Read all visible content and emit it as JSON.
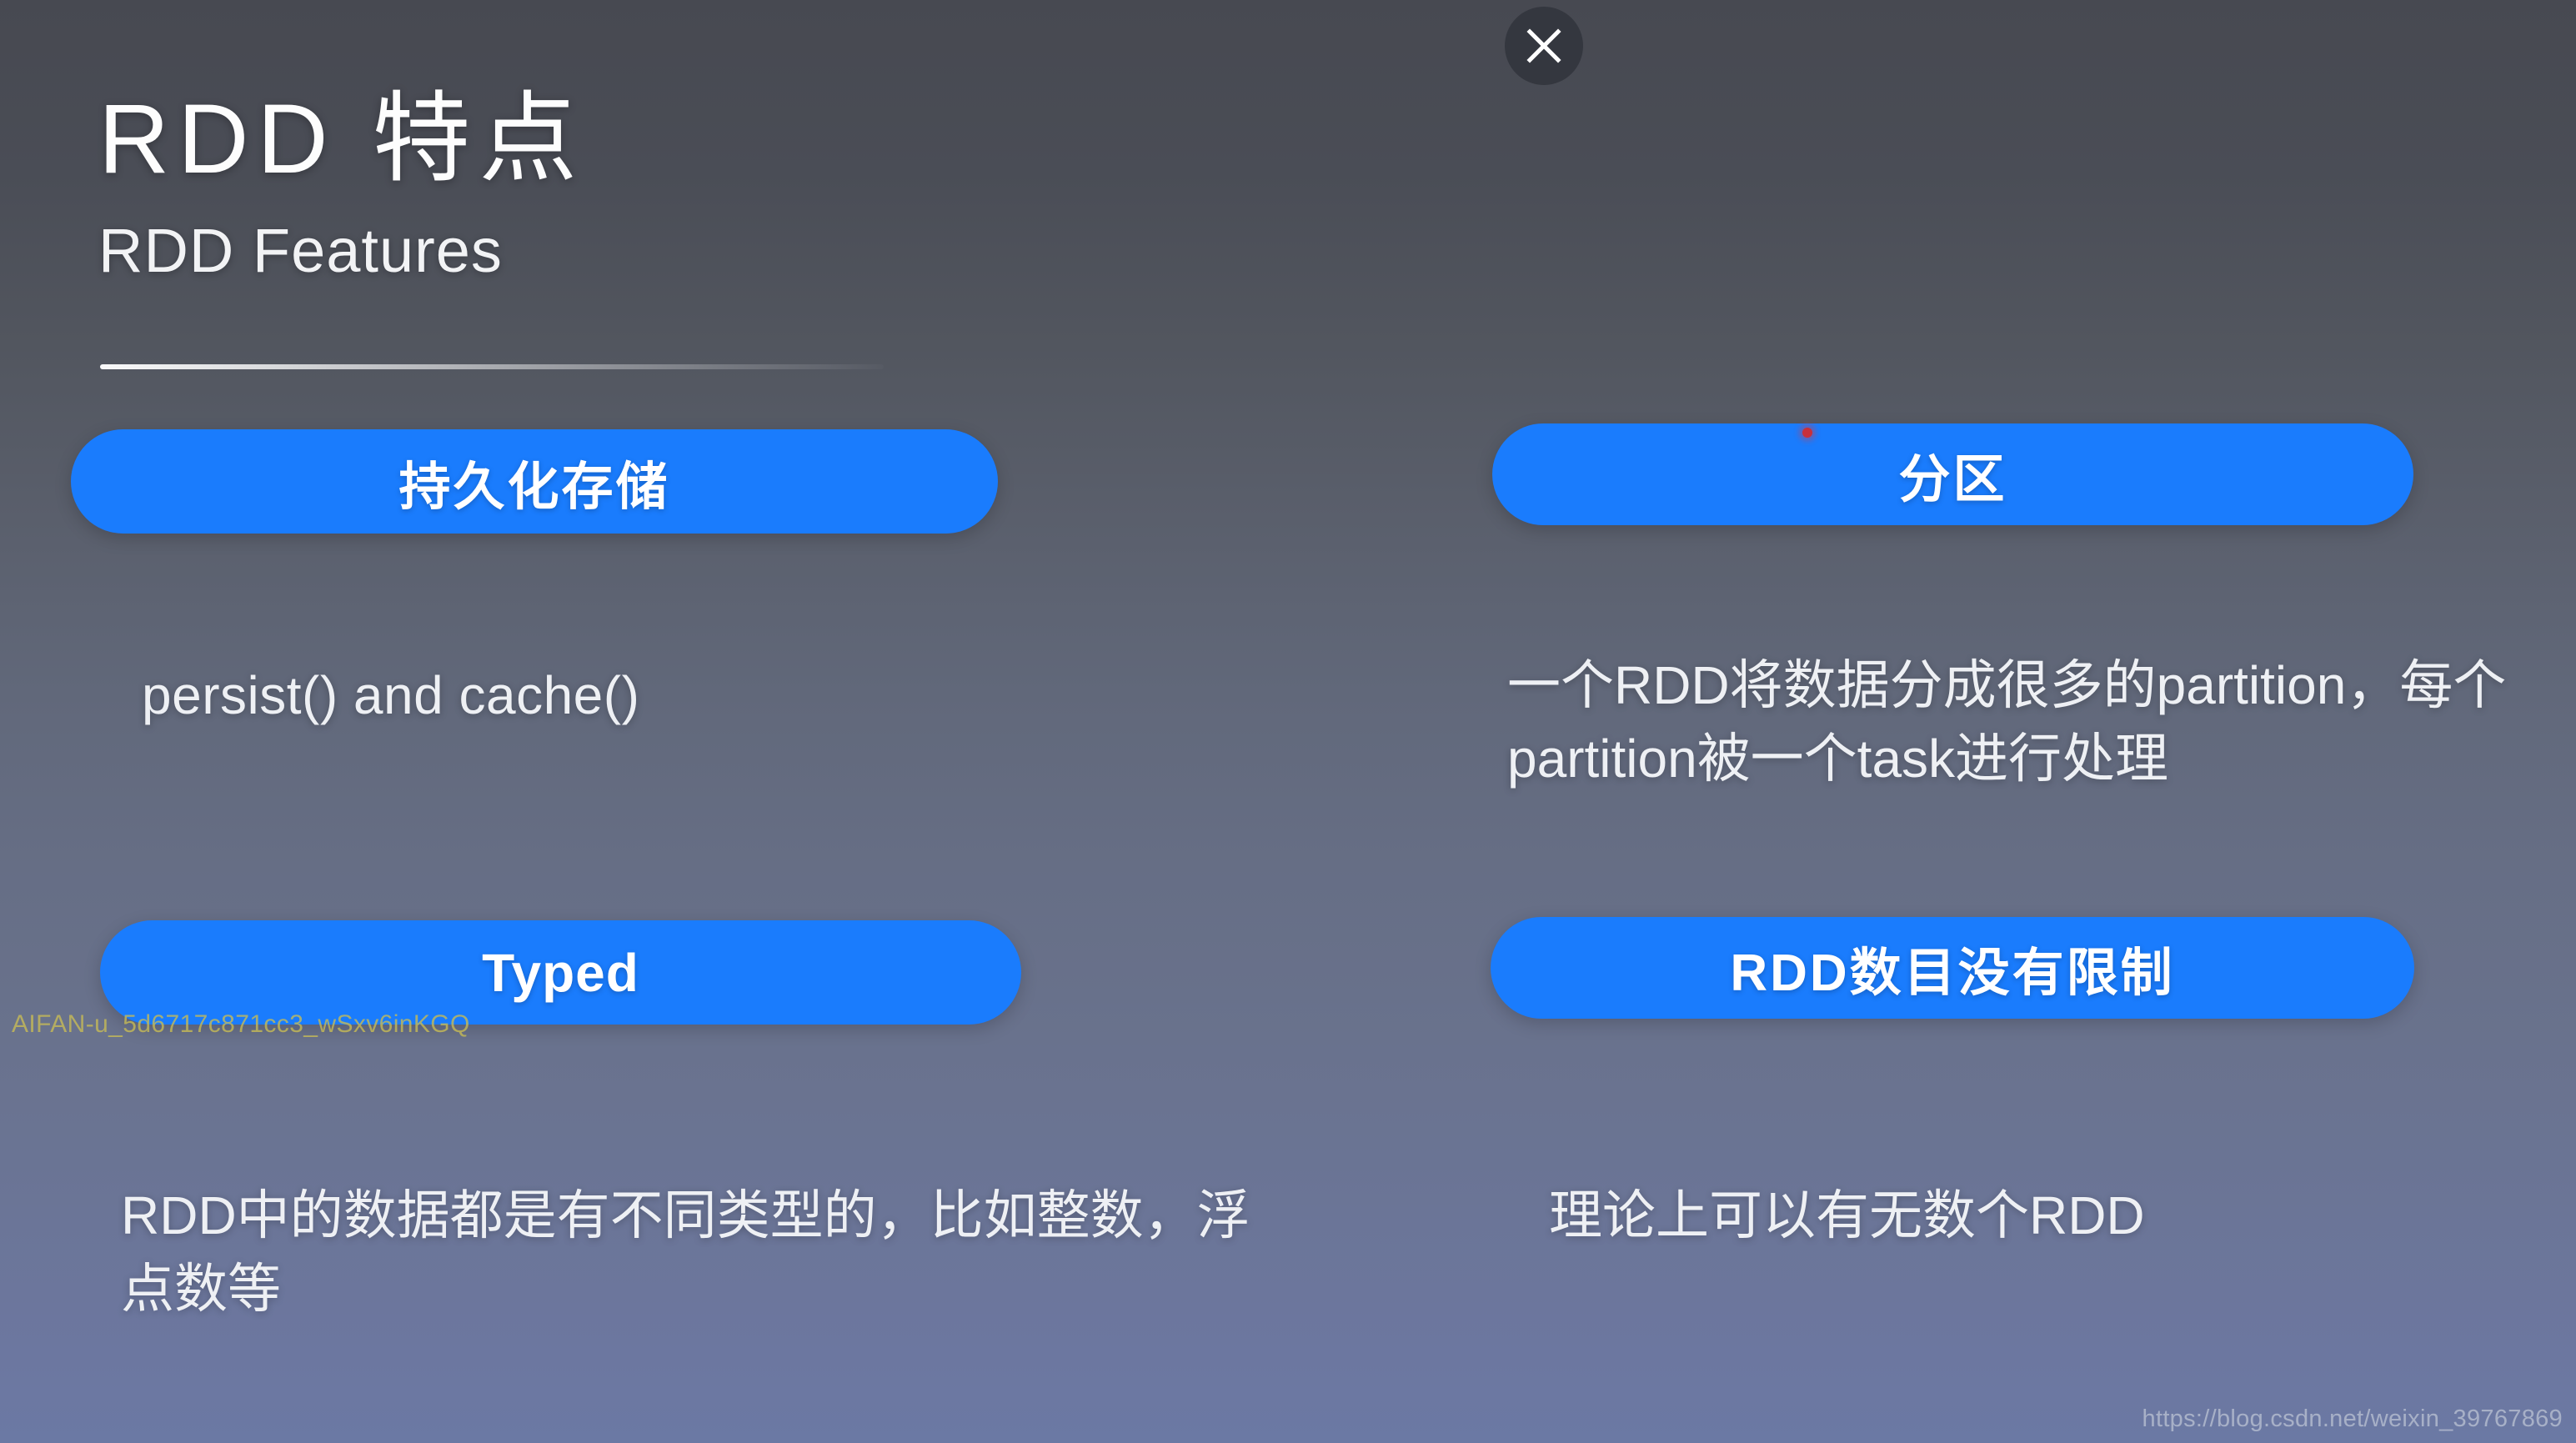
{
  "slide": {
    "title_zh": "RDD 特点",
    "subtitle_en": "RDD Features"
  },
  "close_button": {
    "label": "✕",
    "icon": "close-icon"
  },
  "features": [
    {
      "id": "persist",
      "pill_label": "持久化存储",
      "description": "persist() and cache()"
    },
    {
      "id": "partition",
      "pill_label": "分区",
      "description": "一个RDD将数据分成很多的partition，每个partition被一个task进行处理"
    },
    {
      "id": "typed",
      "pill_label": "Typed",
      "description": "RDD中的数据都是有不同类型的，比如整数，浮点数等"
    },
    {
      "id": "unlimited",
      "pill_label": "RDD数目没有限制",
      "description": "理论上可以有无数个RDD"
    }
  ],
  "watermarks": {
    "left": "AIFAN-u_5d6717c871cc3_wSxv6inKGQ",
    "url": "https://blog.csdn.net/weixin_39767869"
  },
  "colors": {
    "pill_blue": "#1a7cfd",
    "background_top": "#474951",
    "background_bottom": "#6b79a4",
    "close_button": "#34373f",
    "cursor_dot": "#c8303a",
    "watermark_left": "#c9bd55"
  }
}
